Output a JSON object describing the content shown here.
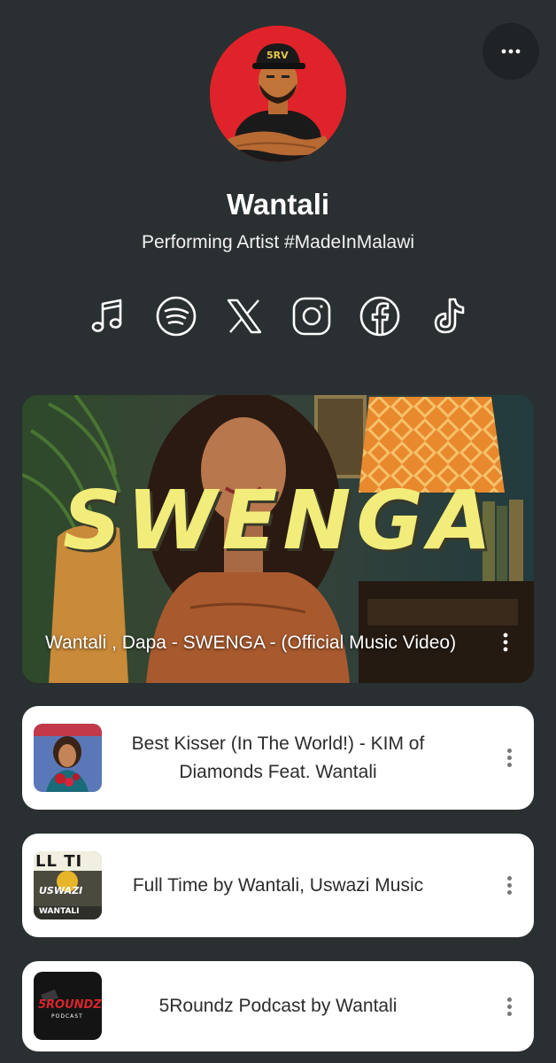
{
  "profile": {
    "name": "Wantali",
    "bio": "Performing Artist #MadeInMalawi",
    "avatar_cap_text": "5RV",
    "avatar_bg": "#e0232a"
  },
  "header": {
    "more_icon": "more-horizontal-icon"
  },
  "socials": [
    {
      "name": "music",
      "icon": "music-note-icon"
    },
    {
      "name": "spotify",
      "icon": "spotify-icon"
    },
    {
      "name": "x",
      "icon": "x-icon"
    },
    {
      "name": "instagram",
      "icon": "instagram-icon"
    },
    {
      "name": "facebook",
      "icon": "facebook-icon"
    },
    {
      "name": "tiktok",
      "icon": "tiktok-icon"
    }
  ],
  "featured_video": {
    "title": "Wantali , Dapa - SWENGA - (Official Music Video)",
    "thumbnail_text": "SWENGA",
    "accent": "#f2ec7a"
  },
  "links": [
    {
      "title": "Best Kisser (In The World!) - KIM of Diamonds Feat. Wantali"
    },
    {
      "title": "Full Time by Wantali, Uswazi Music",
      "thumb_text_top": "LL TI",
      "thumb_text_mid": "USWAZI",
      "thumb_text_bot": "WANTALI"
    },
    {
      "title": "5Roundz Podcast by Wantali",
      "thumb_text": "5ROUNDZ",
      "thumb_sub": "PODCAST"
    }
  ],
  "colors": {
    "background": "#2a2f31",
    "card": "#ffffff",
    "card_text": "#2c2c2c"
  }
}
